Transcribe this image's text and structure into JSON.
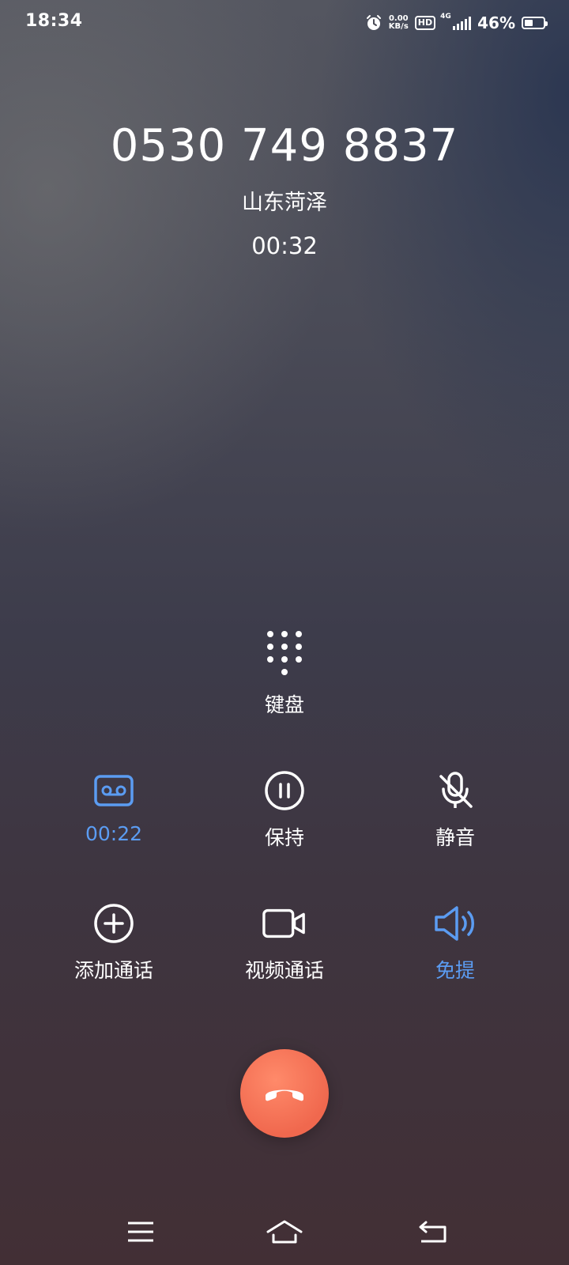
{
  "status_bar": {
    "time": "18:34",
    "net_speed_value": "0.00",
    "net_speed_unit": "KB/s",
    "hd_label": "HD",
    "network_type": "4G",
    "battery_percent": "46%",
    "battery_level": 0.46,
    "icons": [
      "alarm-icon",
      "hd-icon",
      "signal-icon",
      "battery-icon"
    ]
  },
  "caller": {
    "number": "0530 749 8837",
    "location": "山东菏泽",
    "duration": "00:32"
  },
  "keypad": {
    "label": "键盘",
    "icon": "dialpad-icon"
  },
  "actions": [
    {
      "name": "record",
      "label": "00:22",
      "icon": "record-icon",
      "active": true
    },
    {
      "name": "hold",
      "label": "保持",
      "icon": "pause-icon",
      "active": false
    },
    {
      "name": "mute",
      "label": "静音",
      "icon": "mic-off-icon",
      "active": false
    },
    {
      "name": "add-call",
      "label": "添加通话",
      "icon": "plus-circle-icon",
      "active": false
    },
    {
      "name": "video-call",
      "label": "视频通话",
      "icon": "video-icon",
      "active": false
    },
    {
      "name": "speaker",
      "label": "免提",
      "icon": "speaker-icon",
      "active": true
    }
  ],
  "colors": {
    "accent": "#5b9cf2",
    "end_call": "#f0684e"
  },
  "nav": {
    "icons": [
      "menu-icon",
      "home-icon",
      "back-icon"
    ]
  }
}
